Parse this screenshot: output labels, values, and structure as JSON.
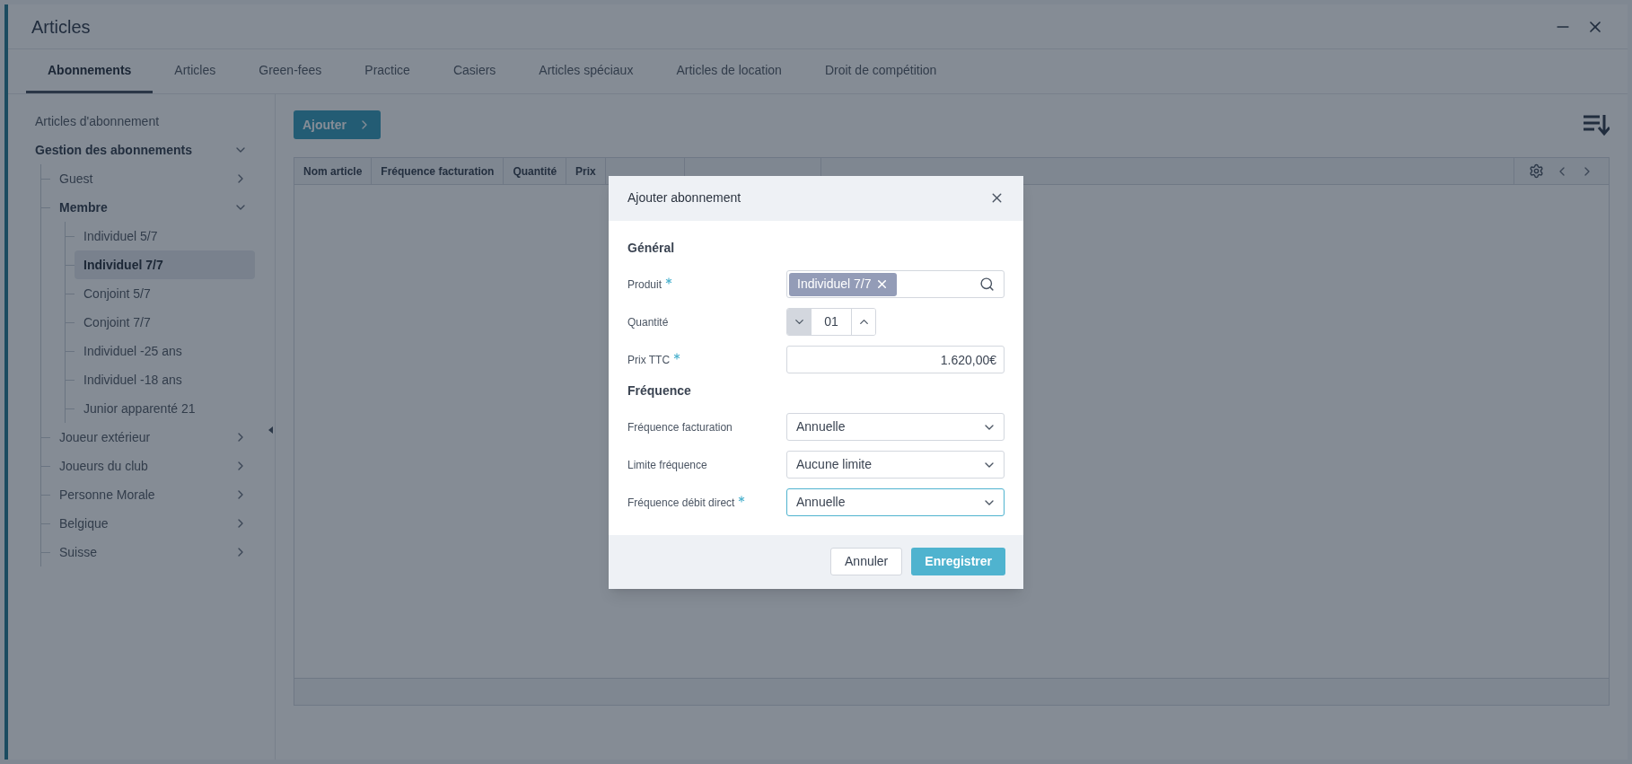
{
  "window": {
    "title": "Articles"
  },
  "tabs": [
    {
      "label": "Abonnements",
      "selected": true
    },
    {
      "label": "Articles",
      "selected": false
    },
    {
      "label": "Green-fees",
      "selected": false
    },
    {
      "label": "Practice",
      "selected": false
    },
    {
      "label": "Casiers",
      "selected": false
    },
    {
      "label": "Articles spéciaux",
      "selected": false
    },
    {
      "label": "Articles de location",
      "selected": false
    },
    {
      "label": "Droit de compétition",
      "selected": false
    }
  ],
  "sidebar": {
    "items": [
      {
        "label": "Articles d'abonnement",
        "selected": false
      },
      {
        "label": "Gestion des abonnements",
        "selected": false,
        "expanded": true,
        "children": [
          {
            "label": "Guest",
            "selected": false,
            "expanded": false
          },
          {
            "label": "Membre",
            "selected": false,
            "expanded": true,
            "children": [
              {
                "label": "Individuel 5/7",
                "selected": false
              },
              {
                "label": "Individuel 7/7",
                "selected": true
              },
              {
                "label": "Conjoint 5/7",
                "selected": false
              },
              {
                "label": "Conjoint 7/7",
                "selected": false
              },
              {
                "label": "Individuel -25 ans",
                "selected": false
              },
              {
                "label": "Individuel -18 ans",
                "selected": false
              },
              {
                "label": "Junior apparenté 21",
                "selected": false
              }
            ]
          },
          {
            "label": "Joueur extérieur",
            "selected": false,
            "expanded": false
          },
          {
            "label": "Joueurs du club",
            "selected": false,
            "expanded": false
          },
          {
            "label": "Personne Morale",
            "selected": false,
            "expanded": false
          },
          {
            "label": "Belgique",
            "selected": false,
            "expanded": false
          },
          {
            "label": "Suisse",
            "selected": false,
            "expanded": false
          }
        ]
      }
    ]
  },
  "toolbar": {
    "add_button": "Ajouter"
  },
  "table": {
    "columns": [
      "Nom article",
      "Fréquence facturation",
      "Quantité",
      "Prix"
    ]
  },
  "dialog": {
    "title": "Ajouter abonnement",
    "sections": [
      {
        "heading": "Général",
        "fields": [
          {
            "kind": "tags",
            "label": "Produit",
            "required": true,
            "tags": [
              "Individuel 7/7"
            ]
          },
          {
            "kind": "stepper",
            "label": "Quantité",
            "required": false,
            "value": "01",
            "decrease_disabled": true
          },
          {
            "kind": "text",
            "label": "Prix TTC",
            "required": true,
            "value": "1.620,00€"
          }
        ]
      },
      {
        "heading": "Fréquence",
        "fields": [
          {
            "kind": "select",
            "label": "Fréquence facturation",
            "required": false,
            "value": "Annuelle",
            "focused": false
          },
          {
            "kind": "select",
            "label": "Limite fréquence",
            "required": false,
            "value": "Aucune limite",
            "focused": false
          },
          {
            "kind": "select",
            "label": "Fréquence débit direct",
            "required": true,
            "value": "Annuelle",
            "focused": true
          }
        ]
      }
    ],
    "buttons": [
      {
        "label": "Annuler",
        "kind": "secondary"
      },
      {
        "label": "Enregistrer",
        "kind": "primary"
      }
    ]
  }
}
